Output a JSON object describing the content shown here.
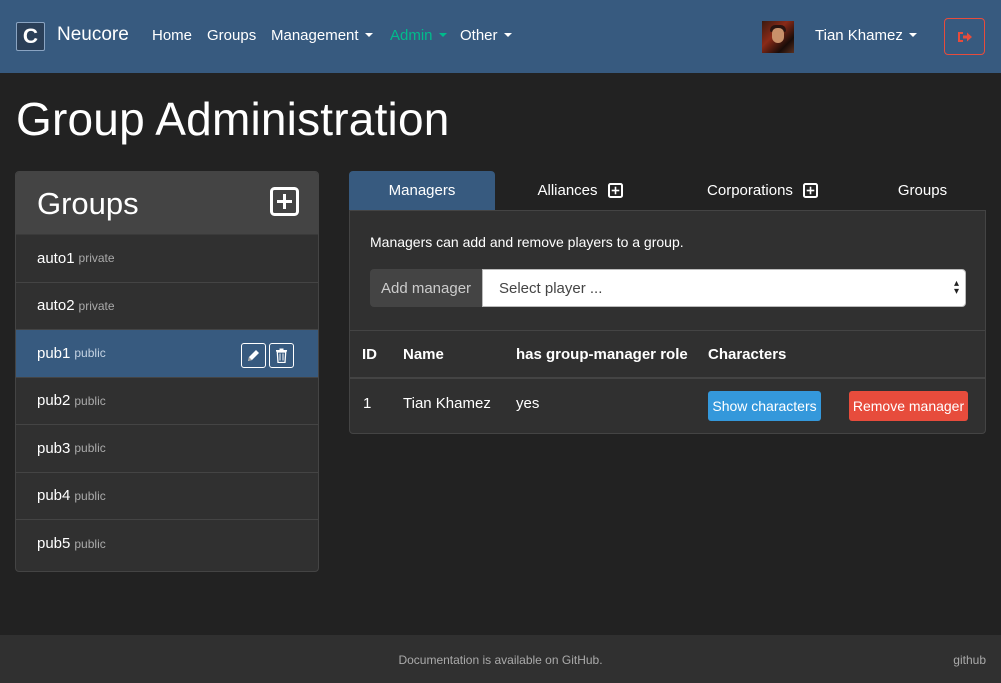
{
  "navbar": {
    "logo_letter": "C",
    "brand": "Neucore",
    "items": [
      {
        "label": "Home"
      },
      {
        "label": "Groups"
      },
      {
        "label": "Management"
      },
      {
        "label": "Admin"
      },
      {
        "label": "Other"
      }
    ],
    "user_name": "Tian Khamez",
    "active_color": "#00bc8c",
    "navbar_color": "#375a7f"
  },
  "page": {
    "title": "Group Administration"
  },
  "groups_panel": {
    "title": "Groups",
    "items": [
      {
        "name": "auto1",
        "visibility": "private"
      },
      {
        "name": "auto2",
        "visibility": "private"
      },
      {
        "name": "pub1",
        "visibility": "public"
      },
      {
        "name": "pub2",
        "visibility": "public"
      },
      {
        "name": "pub3",
        "visibility": "public"
      },
      {
        "name": "pub4",
        "visibility": "public"
      },
      {
        "name": "pub5",
        "visibility": "public"
      }
    ],
    "selected_index": 2
  },
  "tabs": [
    {
      "label": "Managers"
    },
    {
      "label": "Alliances"
    },
    {
      "label": "Corporations"
    },
    {
      "label": "Groups"
    }
  ],
  "managers": {
    "description": "Managers can add and remove players to a group.",
    "add_label": "Add manager",
    "select_value": "Select player ...",
    "columns": [
      "ID",
      "Name",
      "has group-manager role",
      "Characters"
    ],
    "rows": [
      {
        "id": "1",
        "name": "Tian Khamez",
        "role": "yes"
      }
    ],
    "show_characters_label": "Show characters",
    "remove_manager_label": "Remove manager"
  },
  "footer": {
    "text": "Documentation is available on GitHub.",
    "link": "github"
  }
}
